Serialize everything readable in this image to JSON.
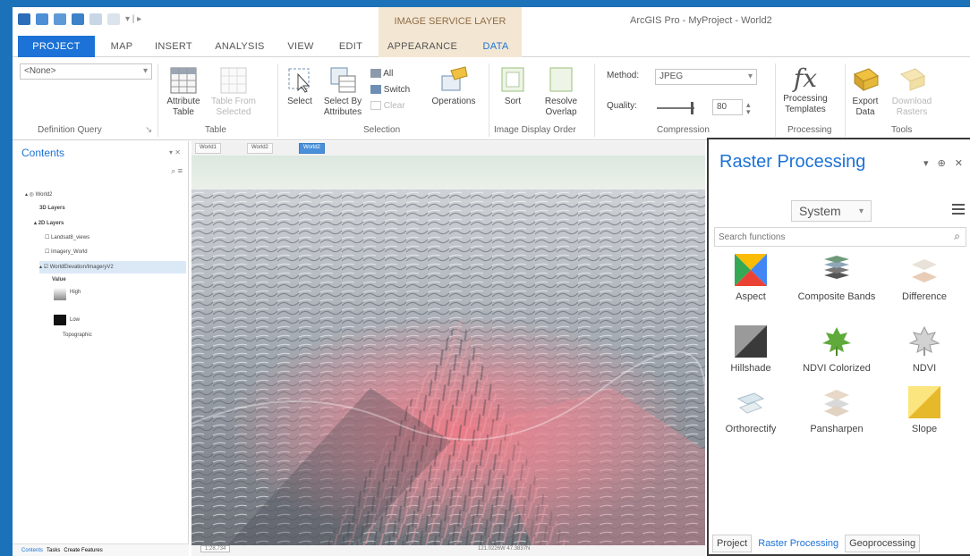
{
  "title_bar": {
    "context_tab": "IMAGE SERVICE LAYER",
    "app_title": "ArcGIS Pro - MyProject - World2"
  },
  "tabs": [
    "PROJECT",
    "MAP",
    "INSERT",
    "ANALYSIS",
    "VIEW",
    "EDIT",
    "APPEARANCE",
    "DATA"
  ],
  "ribbon": {
    "definition_query": {
      "value": "<None>",
      "label": "Definition Query"
    },
    "table": {
      "attribute_table": "Attribute Table",
      "table_from_selected": "Table From Selected",
      "label": "Table"
    },
    "selection": {
      "select": "Select",
      "select_by_attributes": "Select By Attributes",
      "all": "All",
      "switch": "Switch",
      "clear": "Clear",
      "label": "Selection"
    },
    "operations": "Operations",
    "image_display_order": {
      "sort": "Sort",
      "resolve_overlap": "Resolve Overlap",
      "label": "Image Display Order"
    },
    "compression": {
      "method_label": "Method:",
      "method_value": "JPEG",
      "quality_label": "Quality:",
      "quality_value": "80",
      "label": "Compression"
    },
    "processing": {
      "templates": "Processing Templates",
      "label": "Processing"
    },
    "tools": {
      "export_data": "Export Data",
      "download_rasters": "Download Rasters",
      "label": "Tools"
    }
  },
  "contents": {
    "title": "Contents",
    "tree": [
      "World2",
      "3D Layers",
      "2D Layers",
      "Landsat8_views",
      "Imagery_World",
      "WorldElevation/ImageryV2",
      "Value",
      "High",
      "Low",
      "Topographic"
    ],
    "bottom_tabs": [
      "Contents",
      "Tasks",
      "Create Features"
    ]
  },
  "map": {
    "tabs": [
      "World1",
      "World2",
      "World2"
    ],
    "scale": "1:28,734",
    "coords": "121.0226W  47.3837N"
  },
  "raster_processing": {
    "title": "Raster Processing",
    "category": "System",
    "search_placeholder": "Search functions",
    "functions": [
      "Aspect",
      "Composite Bands",
      "Difference",
      "Hillshade",
      "NDVI Colorized",
      "NDVI",
      "Orthorectify",
      "Pansharpen",
      "Slope"
    ],
    "bottom_tabs": [
      "Project",
      "Raster Processing",
      "Geoprocessing"
    ]
  },
  "colors": {
    "accent": "#1c72d6",
    "context_tab_bg": "#f3e7d4",
    "terrain_highlight": "#f07a86"
  }
}
